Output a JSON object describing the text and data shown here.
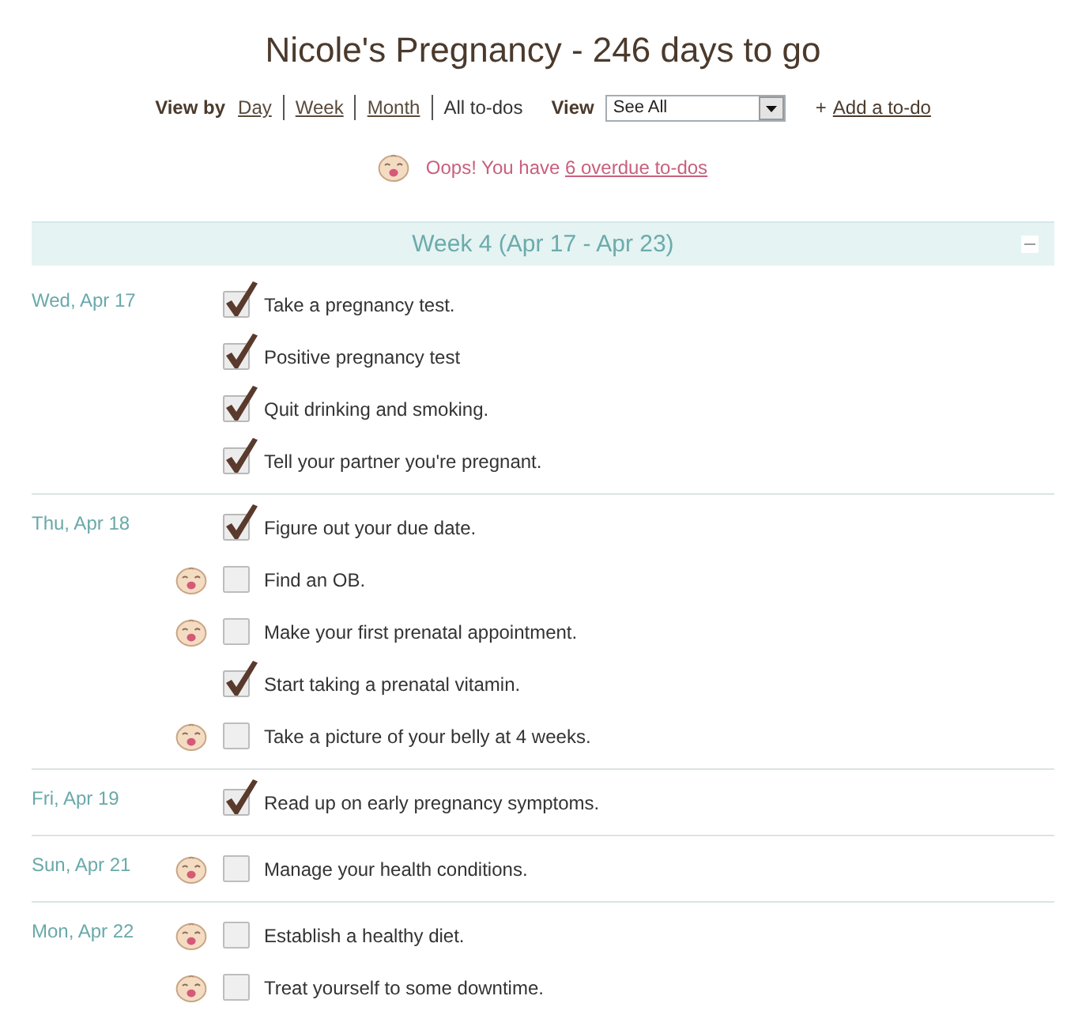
{
  "title": "Nicole's Pregnancy - 246 days to go",
  "nav": {
    "label": "View by",
    "links": [
      {
        "label": "Day",
        "selected": false
      },
      {
        "label": "Week",
        "selected": false
      },
      {
        "label": "Month",
        "selected": false
      },
      {
        "label": "All to-dos",
        "selected": true
      }
    ],
    "view_label": "View",
    "view_select": {
      "value": "See All"
    },
    "add_prefix": "+",
    "add_link": "Add a to-do"
  },
  "alert": {
    "text": "Oops! You have ",
    "link": "6 overdue to-dos"
  },
  "week": {
    "title": "Week 4 (Apr 17 - Apr 23)",
    "expanded": true,
    "days": [
      {
        "date": "Wed, Apr 17",
        "todos": [
          {
            "text": "Take a pregnancy test.",
            "checked": true,
            "overdue": false
          },
          {
            "text": "Positive pregnancy test",
            "checked": true,
            "overdue": false
          },
          {
            "text": "Quit drinking and smoking.",
            "checked": true,
            "overdue": false
          },
          {
            "text": "Tell your partner you're pregnant.",
            "checked": true,
            "overdue": false
          }
        ]
      },
      {
        "date": "Thu, Apr 18",
        "todos": [
          {
            "text": "Figure out your due date.",
            "checked": true,
            "overdue": false
          },
          {
            "text": "Find an OB.",
            "checked": false,
            "overdue": true
          },
          {
            "text": "Make your first prenatal appointment.",
            "checked": false,
            "overdue": true
          },
          {
            "text": "Start taking a prenatal vitamin.",
            "checked": true,
            "overdue": false
          },
          {
            "text": "Take a picture of your belly at 4 weeks.",
            "checked": false,
            "overdue": true
          }
        ]
      },
      {
        "date": "Fri, Apr 19",
        "todos": [
          {
            "text": "Read up on early pregnancy symptoms.",
            "checked": true,
            "overdue": false
          }
        ]
      },
      {
        "date": "Sun, Apr 21",
        "todos": [
          {
            "text": "Manage your health conditions.",
            "checked": false,
            "overdue": true
          }
        ]
      },
      {
        "date": "Mon, Apr 22",
        "todos": [
          {
            "text": "Establish a healthy diet.",
            "checked": false,
            "overdue": true
          },
          {
            "text": "Treat yourself to some downtime.",
            "checked": false,
            "overdue": true
          }
        ]
      }
    ]
  }
}
